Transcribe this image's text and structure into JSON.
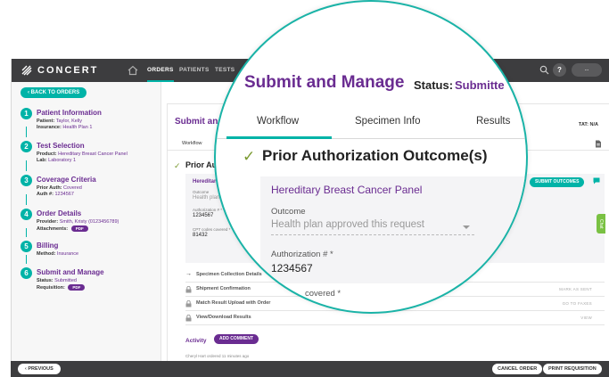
{
  "nav": {
    "logo": "CONCERT",
    "tabs": [
      "ORDERS",
      "PATIENTS",
      "TESTS"
    ],
    "active_tab": "ORDERS",
    "help_icon": "question-icon",
    "user_label": "..."
  },
  "sidebar": {
    "back_label": "BACK TO ORDERS",
    "steps": [
      {
        "num": "1",
        "title": "Patient Information",
        "lines": [
          [
            "Patient:",
            "Taylor, Kelly"
          ],
          [
            "Insurance:",
            "Health Plan 1"
          ]
        ]
      },
      {
        "num": "2",
        "title": "Test Selection",
        "lines": [
          [
            "Product:",
            "Hereditary Breast Cancer Panel"
          ],
          [
            "Lab:",
            "Laboratory 1"
          ]
        ]
      },
      {
        "num": "3",
        "title": "Coverage Criteria",
        "lines": [
          [
            "Prior Auth:",
            "Covered"
          ],
          [
            "Auth #:",
            "1234567"
          ]
        ]
      },
      {
        "num": "4",
        "title": "Order Details",
        "lines": [
          [
            "Provider:",
            "Smith, Kristy (0123456789)"
          ],
          [
            "Attachments:",
            ""
          ]
        ]
      },
      {
        "num": "5",
        "title": "Billing",
        "lines": [
          [
            "Method:",
            "Insurance"
          ]
        ]
      },
      {
        "num": "6",
        "title": "Submit and Manage",
        "lines": [
          [
            "Status:",
            "Submitted"
          ],
          [
            "Requisition:",
            ""
          ]
        ]
      }
    ]
  },
  "main": {
    "title": "Submit and",
    "tat": "TAT: N/A",
    "tab_workflow": "Workflow",
    "pa_title_small": "Prior Au",
    "panel_small": "Hereditary",
    "outcome_label_small": "Outcome",
    "outcome_value_small": "Health plan",
    "auth_label_small": "Authorization # *",
    "auth_value_small": "1234567",
    "cpt_label": "CPT codes covered *",
    "cpt_value": "81432",
    "submit_outcomes": "SUBMIT OUTCOMES",
    "rows": [
      {
        "label": "Specimen Collection Details",
        "action": ""
      },
      {
        "label": "Shipment Confirmation",
        "action": "MARK AS SENT"
      },
      {
        "label": "Match Result Upload with Order",
        "action": "GO TO FAXES"
      },
      {
        "label": "View/Download Results",
        "action": "VIEW"
      }
    ],
    "activity": "Activity",
    "add_comment": "ADD COMMENT",
    "activity_line": "Cheryl Hart ordered 11 minutes ago"
  },
  "magnifier": {
    "title": "Submit and Manage",
    "status_label": "Status:",
    "status_value": "Submitte",
    "tab_workflow": "Workflow",
    "tab_specimen": "Specimen Info",
    "tab_results": "Results",
    "pa_title": "Prior Authorization Outcome(s)",
    "panel": "Hereditary Breast Cancer Panel",
    "outcome_label": "Outcome",
    "outcome_value": "Health plan approved this request",
    "auth_label": "Authorization # *",
    "auth_value": "1234567",
    "cpt_label": "covered *"
  },
  "feedback": "Chat",
  "bottombar": {
    "previous": "PREVIOUS",
    "cancel": "CANCEL ORDER",
    "print": "PRINT REQUISITION"
  },
  "colors": {
    "accent": "#00b3a7",
    "brand": "#6a2c91",
    "nav": "#3d3d3f"
  }
}
